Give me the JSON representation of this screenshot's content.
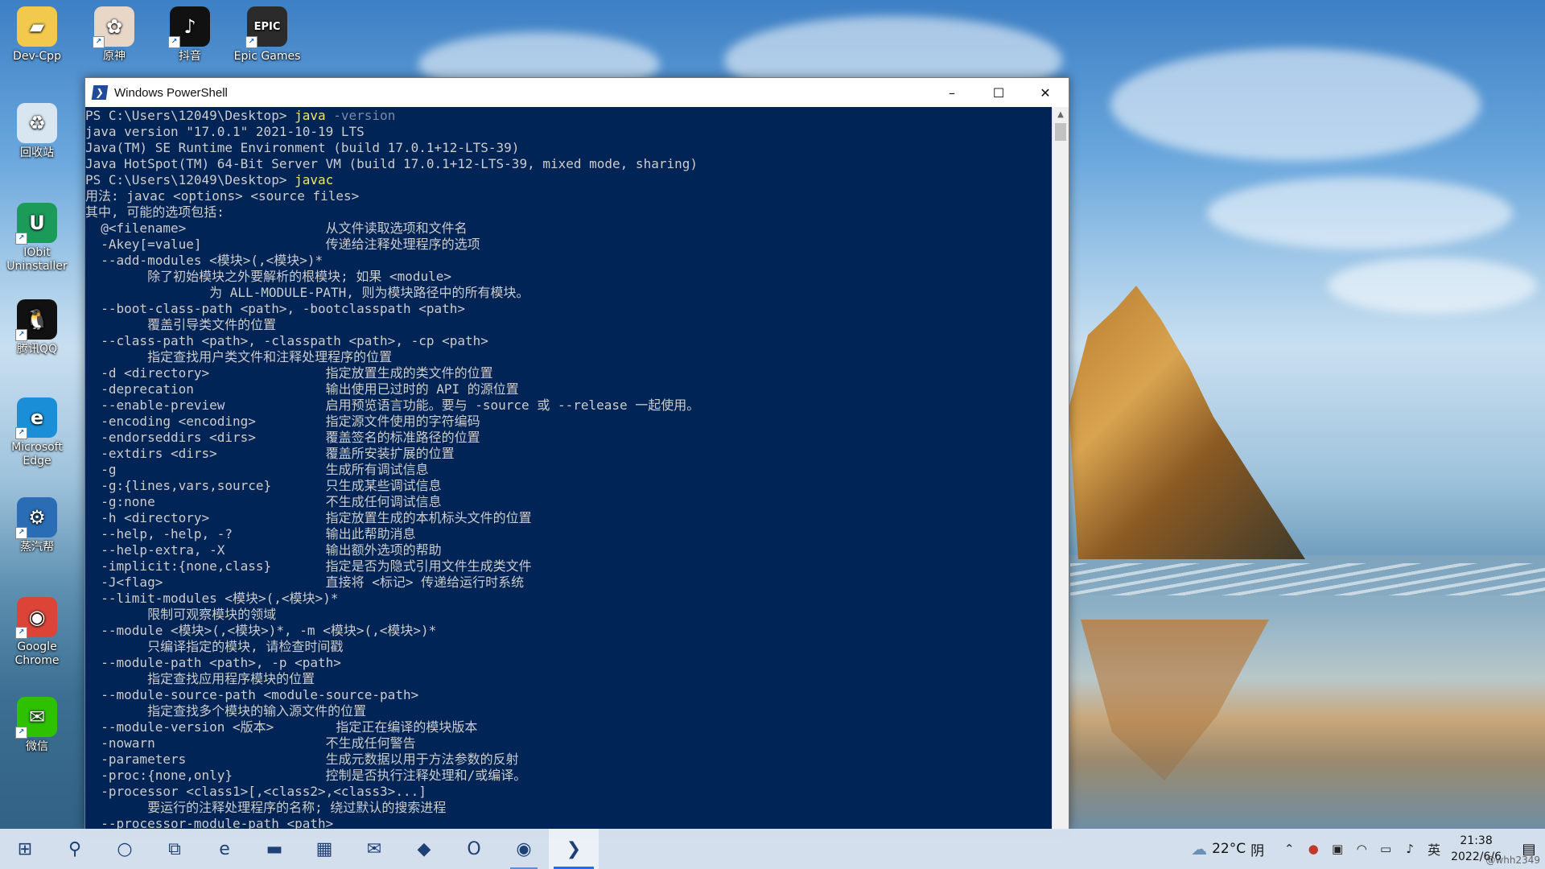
{
  "desktop": {
    "icons": [
      {
        "label": "Dev-Cpp",
        "icon": "folder-icon",
        "color": "#f2c94c"
      },
      {
        "label": "原神",
        "icon": "genshin-icon",
        "color": "#e8d6c6"
      },
      {
        "label": "抖音",
        "icon": "douyin-icon",
        "color": "#111111"
      },
      {
        "label": "Epic Games",
        "icon": "epic-games-icon",
        "color": "#2b2b2b"
      },
      {
        "label": "回收站",
        "icon": "recycle-bin-icon",
        "color": "#d8e6f2"
      },
      {
        "label": "IObit Uninstaller",
        "icon": "iobit-uninstaller-icon",
        "color": "#1b9a5a"
      },
      {
        "label": "腾讯QQ",
        "icon": "qq-icon",
        "color": "#111111"
      },
      {
        "label": "Microsoft Edge",
        "icon": "edge-icon",
        "color": "#1a8fd8"
      },
      {
        "label": "蒸汽帮",
        "icon": "steam-helper-icon",
        "color": "#2a6db5"
      },
      {
        "label": "Google Chrome",
        "icon": "chrome-icon",
        "color": "#db4437"
      },
      {
        "label": "微信",
        "icon": "wechat-icon",
        "color": "#2dc100"
      }
    ]
  },
  "window": {
    "title": "Windows PowerShell",
    "minimize": "–",
    "maximize": "☐",
    "close": "✕"
  },
  "console": {
    "prompt_lines": [
      {
        "prompt": "PS C:\\Users\\12049\\Desktop> ",
        "cmd": "java",
        "arg": " -version"
      },
      {
        "prompt": "PS C:\\Users\\12049\\Desktop> ",
        "cmd": "javac",
        "arg": ""
      }
    ],
    "java_version_output": [
      "java version \"17.0.1\" 2021-10-19 LTS",
      "Java(TM) SE Runtime Environment (build 17.0.1+12-LTS-39)",
      "Java HotSpot(TM) 64-Bit Server VM (build 17.0.1+12-LTS-39, mixed mode, sharing)"
    ],
    "javac_output": [
      "用法: javac <options> <source files>",
      "其中, 可能的选项包括:",
      "  @<filename>                  从文件读取选项和文件名",
      "  -Akey[=value]                传递给注释处理程序的选项",
      "  --add-modules <模块>(,<模块>)*",
      "        除了初始模块之外要解析的根模块; 如果 <module>",
      "                为 ALL-MODULE-PATH, 则为模块路径中的所有模块。",
      "  --boot-class-path <path>, -bootclasspath <path>",
      "        覆盖引导类文件的位置",
      "  --class-path <path>, -classpath <path>, -cp <path>",
      "        指定查找用户类文件和注释处理程序的位置",
      "  -d <directory>               指定放置生成的类文件的位置",
      "  -deprecation                 输出使用已过时的 API 的源位置",
      "  --enable-preview             启用预览语言功能。要与 -source 或 --release 一起使用。",
      "  -encoding <encoding>         指定源文件使用的字符编码",
      "  -endorseddirs <dirs>         覆盖签名的标准路径的位置",
      "  -extdirs <dirs>              覆盖所安装扩展的位置",
      "  -g                           生成所有调试信息",
      "  -g:{lines,vars,source}       只生成某些调试信息",
      "  -g:none                      不生成任何调试信息",
      "  -h <directory>               指定放置生成的本机标头文件的位置",
      "  --help, -help, -?            输出此帮助消息",
      "  --help-extra, -X             输出额外选项的帮助",
      "  -implicit:{none,class}       指定是否为隐式引用文件生成类文件",
      "  -J<flag>                     直接将 <标记> 传递给运行时系统",
      "  --limit-modules <模块>(,<模块>)*",
      "        限制可观察模块的领域",
      "  --module <模块>(,<模块>)*, -m <模块>(,<模块>)*",
      "        只编译指定的模块, 请检查时间戳",
      "  --module-path <path>, -p <path>",
      "        指定查找应用程序模块的位置",
      "  --module-source-path <module-source-path>",
      "        指定查找多个模块的输入源文件的位置",
      "  --module-version <版本>        指定正在编译的模块版本",
      "  -nowarn                      不生成任何警告",
      "  -parameters                  生成元数据以用于方法参数的反射",
      "  -proc:{none,only}            控制是否执行注释处理和/或编译。",
      "  -processor <class1>[,<class2>,<class3>...]",
      "        要运行的注释处理程序的名称; 绕过默认的搜索进程",
      "  --processor-module-path <path>"
    ],
    "colors": {
      "background": "#012456",
      "text": "#cccccc",
      "command": "#f2e65a",
      "argument": "#7a8aa6"
    }
  },
  "taskbar": {
    "buttons": [
      {
        "name": "start-button",
        "icon": "windows-logo-icon",
        "glyph": "⊞"
      },
      {
        "name": "search-button",
        "icon": "search-icon",
        "glyph": "⚲"
      },
      {
        "name": "cortana-button",
        "icon": "cortana-circle-icon",
        "glyph": "○"
      },
      {
        "name": "task-view-button",
        "icon": "task-view-icon",
        "glyph": "⧉"
      },
      {
        "name": "taskbar-edge",
        "icon": "edge-icon",
        "glyph": "e"
      },
      {
        "name": "taskbar-file-explorer",
        "icon": "folder-icon",
        "glyph": "▬"
      },
      {
        "name": "taskbar-store",
        "icon": "store-icon",
        "glyph": "▦"
      },
      {
        "name": "taskbar-mail",
        "icon": "mail-icon",
        "glyph": "✉"
      },
      {
        "name": "taskbar-alienware",
        "icon": "alien-icon",
        "glyph": "◆"
      },
      {
        "name": "taskbar-office",
        "icon": "office-icon",
        "glyph": "O"
      },
      {
        "name": "taskbar-chrome",
        "icon": "chrome-icon",
        "glyph": "◉"
      },
      {
        "name": "taskbar-powershell",
        "icon": "powershell-icon",
        "glyph": "❯"
      }
    ],
    "tray": {
      "weather_temp": "22°C",
      "weather_cond": "阴",
      "ime": "英",
      "time": "21:38",
      "date": "2022/6/6",
      "watermark": "@whh2349"
    }
  }
}
